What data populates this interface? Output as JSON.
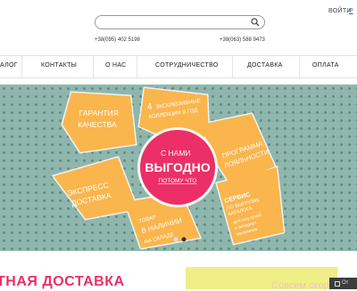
{
  "header": {
    "search_placeholder": "",
    "login": "ВОЙТИ",
    "lang": "Р",
    "phone1": "+38(095) 402 5198",
    "phone2": "+38(063) 588 9473"
  },
  "nav": {
    "items": [
      "АЛОГ",
      "КОНТАКТЫ",
      "О НАС",
      "СОТРУДНИЧЕСТВО",
      "ДОСТАВКА",
      "ОПЛАТА"
    ]
  },
  "hero": {
    "petals": {
      "guarantee": [
        "ГАРАНТИЯ",
        "КАЧЕСТВА"
      ],
      "exclusive": [
        "4",
        "ЭКСКЛЮЗИВНЫЕ",
        "КОЛЛЕКЦИИ В ГОД"
      ],
      "loyalty": [
        "ПРОГРАММА",
        "ЛОЯЛЬНОСТИ"
      ],
      "express": [
        "ЭКСПРЕСС",
        "ДОСТАВКА"
      ],
      "stock": [
        "ТОВАР",
        "В НАЛИЧИИ",
        "НА СКЛАДЕ"
      ],
      "service": [
        "СЕРВИС",
        "ПО ВЫГРУЗКЕ",
        "КАТАЛОГА",
        "для соц сетей",
        "и интернет",
        "магазинов"
      ]
    },
    "center": {
      "line1": "С НАМИ",
      "line2": "ВЫГОДНО",
      "link": "ПОТОМУ ЧТО"
    },
    "slider_dots": 2,
    "active_dot": 0
  },
  "bottom": {
    "delivery_text": "ТНАЯ ДОСТАВКА",
    "promo_text": "Совсем скоро",
    "chat_label": "От"
  },
  "colors": {
    "accent": "#ec2f66",
    "petal": "#fab54d",
    "hero_bg": "#8fb6ad",
    "promo_bg": "#f0ee86"
  }
}
